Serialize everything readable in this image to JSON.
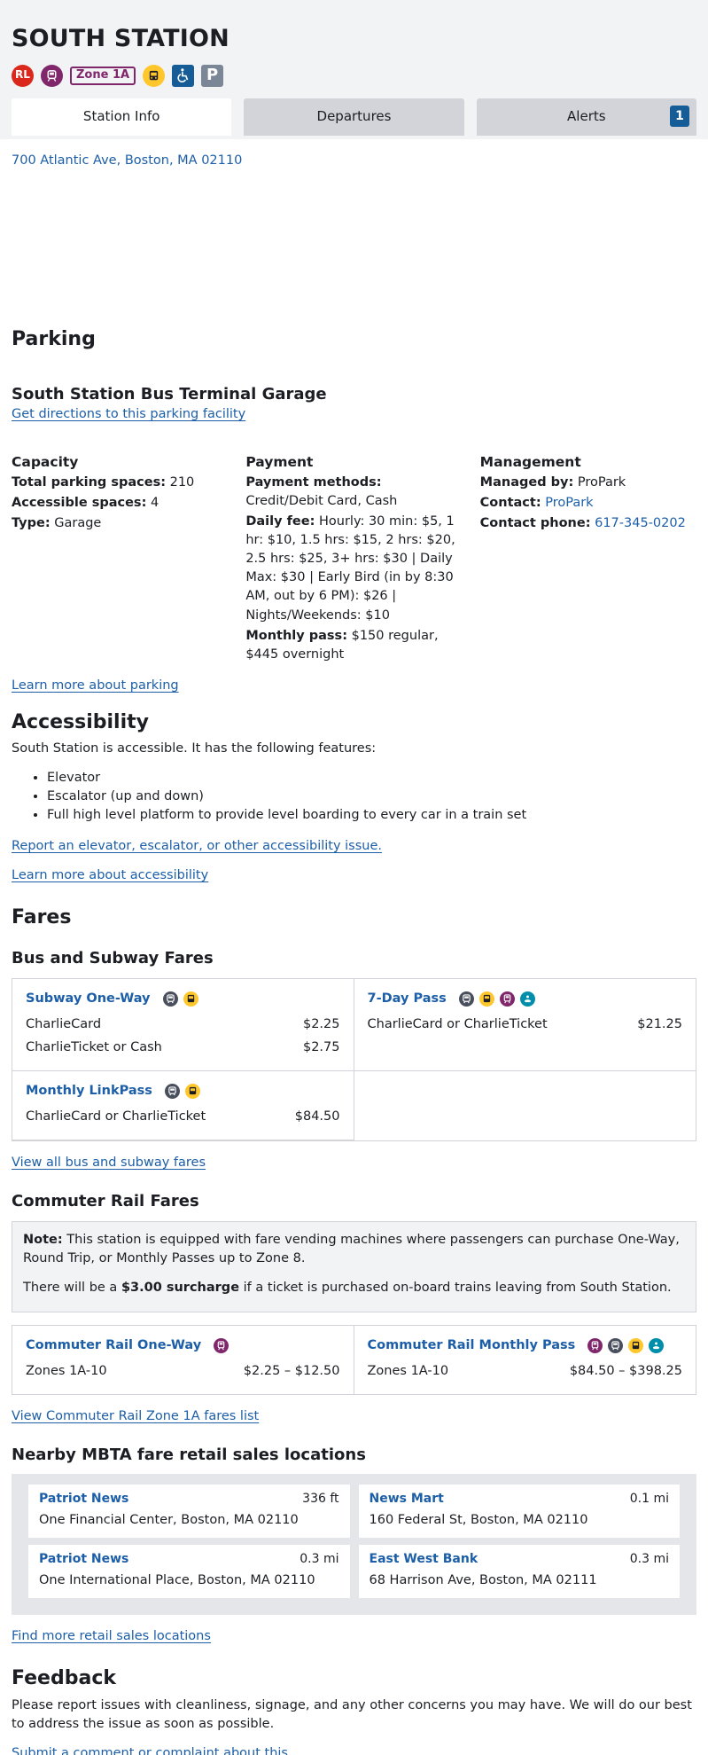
{
  "header": {
    "title": "SOUTH STATION",
    "badges": {
      "red_line": "RL",
      "zone": "Zone 1A",
      "parking": "P"
    }
  },
  "tabs": [
    {
      "label": "Station Info"
    },
    {
      "label": "Departures"
    },
    {
      "label": "Alerts",
      "count": "1"
    }
  ],
  "address": "700 Atlantic Ave, Boston, MA 02110",
  "parking": {
    "heading": "Parking",
    "facility": "South Station Bus Terminal Garage",
    "directions_link": "Get directions to this parking facility",
    "capacity": {
      "heading": "Capacity",
      "total_label": "Total parking spaces:",
      "total": "210",
      "accessible_label": "Accessible spaces:",
      "accessible": "4",
      "type_label": "Type:",
      "type": "Garage"
    },
    "payment": {
      "heading": "Payment",
      "methods_label": "Payment methods:",
      "methods": "Credit/Debit Card, Cash",
      "fee_label": "Daily fee:",
      "fee": "Hourly: 30 min: $5, 1 hr: $10, 1.5 hrs: $15, 2 hrs: $20, 2.5 hrs: $25, 3+ hrs: $30 | Daily Max: $30 | Early Bird (in by 8:30 AM, out by 6 PM): $26 | Nights/Weekends: $10",
      "monthly_label": "Monthly pass:",
      "monthly": "$150 regular, $445 overnight"
    },
    "management": {
      "heading": "Management",
      "managed_label": "Managed by:",
      "managed": "ProPark",
      "contact_label": "Contact:",
      "contact": "ProPark",
      "phone_label": "Contact phone:",
      "phone": "617-345-0202"
    },
    "learn_more": "Learn more about parking"
  },
  "accessibility": {
    "heading": "Accessibility",
    "intro": "South Station is accessible. It has the following features:",
    "features": [
      "Elevator",
      "Escalator (up and down)",
      "Full high level platform to provide level boarding to every car in a train set"
    ],
    "report_link": "Report an elevator, escalator, or other accessibility issue.",
    "learn_more": "Learn more about accessibility"
  },
  "fares": {
    "heading": "Fares",
    "bus_subway": {
      "heading": "Bus and Subway Fares",
      "cards": [
        {
          "name": "Subway One-Way",
          "rows": [
            {
              "label": "CharlieCard",
              "price": "$2.25"
            },
            {
              "label": "CharlieTicket or Cash",
              "price": "$2.75"
            }
          ]
        },
        {
          "name": "7-Day Pass",
          "rows": [
            {
              "label": "CharlieCard or CharlieTicket",
              "price": "$21.25"
            }
          ]
        },
        {
          "name": "Monthly LinkPass",
          "rows": [
            {
              "label": "CharlieCard or CharlieTicket",
              "price": "$84.50"
            }
          ]
        }
      ],
      "view_all": "View all bus and subway fares"
    },
    "commuter": {
      "heading": "Commuter Rail Fares",
      "note_label": "Note:",
      "note": "This station is equipped with fare vending machines where passengers can purchase One-Way, Round Trip, or Monthly Passes up to Zone 8.",
      "surcharge_pre": "There will be a",
      "surcharge_amount": "$3.00 surcharge",
      "surcharge_post": "if a ticket is purchased on-board trains leaving from South Station.",
      "cards": [
        {
          "name": "Commuter Rail One-Way",
          "zones": "Zones 1A-10",
          "price": "$2.25 – $12.50"
        },
        {
          "name": "Commuter Rail Monthly Pass",
          "zones": "Zones 1A-10",
          "price": "$84.50 – $398.25"
        }
      ],
      "view_zone": "View Commuter Rail Zone 1A fares list"
    },
    "retail": {
      "heading": "Nearby MBTA fare retail sales locations",
      "locations": [
        {
          "name": "Patriot News",
          "distance": "336 ft",
          "address": "One Financial Center, Boston, MA 02110"
        },
        {
          "name": "News Mart",
          "distance": "0.1 mi",
          "address": "160 Federal St, Boston, MA 02110"
        },
        {
          "name": "Patriot News",
          "distance": "0.3 mi",
          "address": "One International Place, Boston, MA 02110"
        },
        {
          "name": "East West Bank",
          "distance": "0.3 mi",
          "address": "68 Harrison Ave, Boston, MA 02111"
        }
      ],
      "find_more": "Find more retail sales locations"
    }
  },
  "feedback": {
    "heading": "Feedback",
    "text": "Please report issues with cleanliness, signage, and any other concerns you may have. We will do our best to address the issue as soon as possible.",
    "link": "Submit a comment or complaint about this"
  }
}
